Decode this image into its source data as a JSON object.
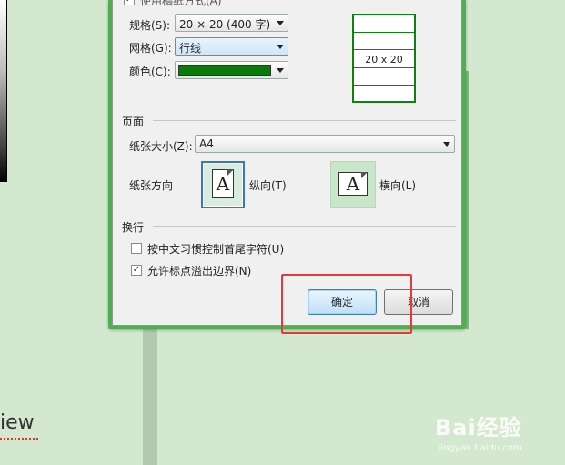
{
  "background": {
    "partial_word": "iew"
  },
  "grid_section": {
    "top_checkbox_label": "使用稿纸方式(A)",
    "size_label": "规格(S):",
    "size_value": "20 × 20 (400 字)",
    "grid_label": "网格(G):",
    "grid_value": "行线",
    "color_label": "颜色(C):",
    "color_value": "#0a7a0a",
    "preview_label": "20 x 20"
  },
  "page_section": {
    "header": "页面",
    "paper_size_label": "纸张大小(Z):",
    "paper_size_value": "A4",
    "orientation_label": "纸张方向",
    "portrait_label": "纵向(T)",
    "landscape_label": "横向(L)",
    "page_glyph": "A"
  },
  "wrap_section": {
    "header": "换行",
    "option1_label": "按中文习惯控制首尾字符(U)",
    "option1_checked": false,
    "option2_label": "允许标点溢出边界(N)",
    "option2_checked": true,
    "check_mark": "✓"
  },
  "buttons": {
    "ok_label": "确定",
    "cancel_label": "取消"
  },
  "watermark": {
    "brand": "Bai经验",
    "url": "jingyan.baidu.com"
  },
  "colors": {
    "dialog_frame": "#4fae4f",
    "highlight": "#e63a3a",
    "grid_green": "#108010"
  }
}
